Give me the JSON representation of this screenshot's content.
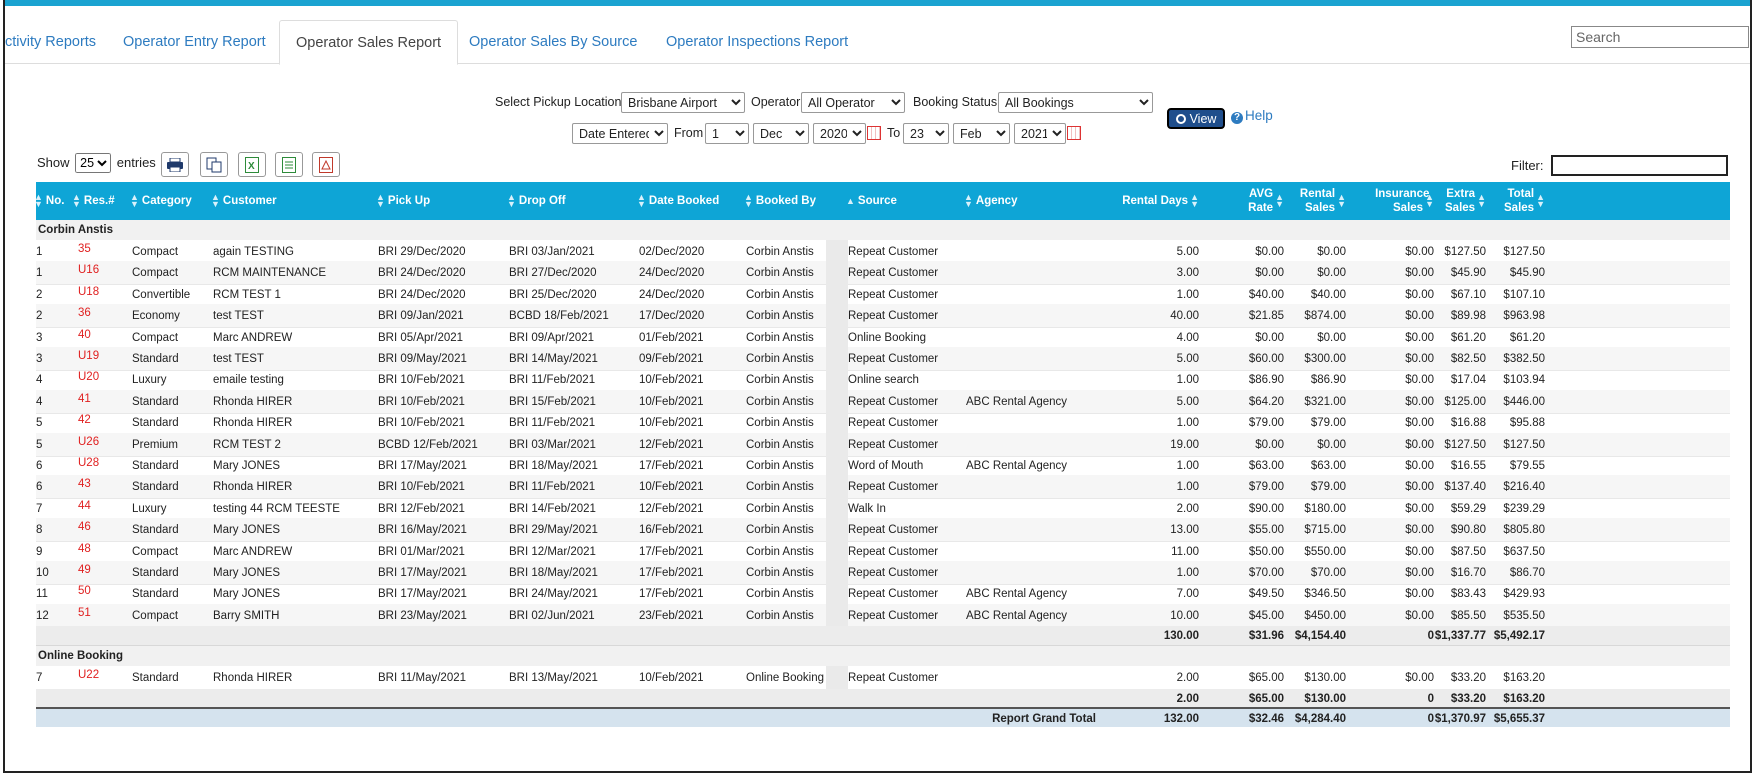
{
  "tabs": [
    {
      "label": "ctivity Reports",
      "left": 0
    },
    {
      "label": "Operator Entry Report"
    },
    {
      "label": "Operator Sales Report",
      "active": true
    },
    {
      "label": "Operator Sales By Source"
    },
    {
      "label": "Operator Inspections Report"
    }
  ],
  "search": {
    "placeholder": "Search"
  },
  "filters": {
    "pickup_label": "Select Pickup Location",
    "pickup_value": "Brisbane Airport",
    "operator_label": "Operator",
    "operator_value": "All Operator",
    "status_label": "Booking Status",
    "status_value": "All Bookings",
    "date_type": "Date Entered",
    "from_label": "From",
    "from_day": "1",
    "from_month": "Dec",
    "from_year": "2020",
    "to_label": "To",
    "to_day": "23",
    "to_month": "Feb",
    "to_year": "2021",
    "view_label": "View",
    "help_label": "Help"
  },
  "table_controls": {
    "show_label": "Show",
    "entries_value": "25",
    "entries_label": "entries",
    "filter_label": "Filter:"
  },
  "columns": [
    "No.",
    "Res.#",
    "Category",
    "Customer",
    "Pick Up",
    "Drop Off",
    "Date Booked",
    "Booked By",
    "Source",
    "Agency",
    "Rental Days",
    "AVG Rate",
    "Rental Sales",
    "Insurance Sales",
    "Extra Sales",
    "Total Sales"
  ],
  "groups": [
    {
      "name": "Corbin Anstis",
      "rows": [
        [
          "1",
          "35",
          "Compact",
          "again TESTING",
          "BRI 29/Dec/2020",
          "BRI 03/Jan/2021",
          "02/Dec/2020",
          "Corbin Anstis",
          "Repeat Customer",
          "",
          "5.00",
          "$0.00",
          "$0.00",
          "$0.00",
          "$127.50",
          "$127.50"
        ],
        [
          "1",
          "U16",
          "Compact",
          "RCM MAINTENANCE",
          "BRI 24/Dec/2020",
          "BRI 27/Dec/2020",
          "24/Dec/2020",
          "Corbin Anstis",
          "Repeat Customer",
          "",
          "3.00",
          "$0.00",
          "$0.00",
          "$0.00",
          "$45.90",
          "$45.90"
        ],
        [
          "2",
          "U18",
          "Convertible",
          "RCM TEST 1",
          "BRI 24/Dec/2020",
          "BRI 25/Dec/2020",
          "24/Dec/2020",
          "Corbin Anstis",
          "Repeat Customer",
          "",
          "1.00",
          "$40.00",
          "$40.00",
          "$0.00",
          "$67.10",
          "$107.10"
        ],
        [
          "2",
          "36",
          "Economy",
          "test TEST",
          "BRI 09/Jan/2021",
          "BCBD 18/Feb/2021",
          "17/Dec/2020",
          "Corbin Anstis",
          "Repeat Customer",
          "",
          "40.00",
          "$21.85",
          "$874.00",
          "$0.00",
          "$89.98",
          "$963.98"
        ],
        [
          "3",
          "40",
          "Compact",
          "Marc ANDREW",
          "BRI 05/Apr/2021",
          "BRI 09/Apr/2021",
          "01/Feb/2021",
          "Corbin Anstis",
          "Online Booking",
          "",
          "4.00",
          "$0.00",
          "$0.00",
          "$0.00",
          "$61.20",
          "$61.20"
        ],
        [
          "3",
          "U19",
          "Standard",
          "test TEST",
          "BRI 09/May/2021",
          "BRI 14/May/2021",
          "09/Feb/2021",
          "Corbin Anstis",
          "Repeat Customer",
          "",
          "5.00",
          "$60.00",
          "$300.00",
          "$0.00",
          "$82.50",
          "$382.50"
        ],
        [
          "4",
          "U20",
          "Luxury",
          "emaile testing",
          "BRI 10/Feb/2021",
          "BRI 11/Feb/2021",
          "10/Feb/2021",
          "Corbin Anstis",
          "Online search",
          "",
          "1.00",
          "$86.90",
          "$86.90",
          "$0.00",
          "$17.04",
          "$103.94"
        ],
        [
          "4",
          "41",
          "Standard",
          "Rhonda HIRER",
          "BRI 10/Feb/2021",
          "BRI 15/Feb/2021",
          "10/Feb/2021",
          "Corbin Anstis",
          "Repeat Customer",
          "ABC Rental Agency",
          "5.00",
          "$64.20",
          "$321.00",
          "$0.00",
          "$125.00",
          "$446.00"
        ],
        [
          "5",
          "42",
          "Standard",
          "Rhonda HIRER",
          "BRI 10/Feb/2021",
          "BRI 11/Feb/2021",
          "10/Feb/2021",
          "Corbin Anstis",
          "Repeat Customer",
          "",
          "1.00",
          "$79.00",
          "$79.00",
          "$0.00",
          "$16.88",
          "$95.88"
        ],
        [
          "5",
          "U26",
          "Premium",
          "RCM TEST 2",
          "BCBD 12/Feb/2021",
          "BRI 03/Mar/2021",
          "12/Feb/2021",
          "Corbin Anstis",
          "Repeat Customer",
          "",
          "19.00",
          "$0.00",
          "$0.00",
          "$0.00",
          "$127.50",
          "$127.50"
        ],
        [
          "6",
          "U28",
          "Standard",
          "Mary JONES",
          "BRI 17/May/2021",
          "BRI 18/May/2021",
          "17/Feb/2021",
          "Corbin Anstis",
          "Word of Mouth",
          "ABC Rental Agency",
          "1.00",
          "$63.00",
          "$63.00",
          "$0.00",
          "$16.55",
          "$79.55"
        ],
        [
          "6",
          "43",
          "Standard",
          "Rhonda HIRER",
          "BRI 10/Feb/2021",
          "BRI 11/Feb/2021",
          "10/Feb/2021",
          "Corbin Anstis",
          "Repeat Customer",
          "",
          "1.00",
          "$79.00",
          "$79.00",
          "$0.00",
          "$137.40",
          "$216.40"
        ],
        [
          "7",
          "44",
          "Luxury",
          "testing 44 RCM TEESTE",
          "BRI 12/Feb/2021",
          "BRI 14/Feb/2021",
          "12/Feb/2021",
          "Corbin Anstis",
          "Walk In",
          "",
          "2.00",
          "$90.00",
          "$180.00",
          "$0.00",
          "$59.29",
          "$239.29"
        ],
        [
          "8",
          "46",
          "Standard",
          "Mary JONES",
          "BRI 16/May/2021",
          "BRI 29/May/2021",
          "16/Feb/2021",
          "Corbin Anstis",
          "Repeat Customer",
          "",
          "13.00",
          "$55.00",
          "$715.00",
          "$0.00",
          "$90.80",
          "$805.80"
        ],
        [
          "9",
          "48",
          "Compact",
          "Marc ANDREW",
          "BRI 01/Mar/2021",
          "BRI 12/Mar/2021",
          "17/Feb/2021",
          "Corbin Anstis",
          "Repeat Customer",
          "",
          "11.00",
          "$50.00",
          "$550.00",
          "$0.00",
          "$87.50",
          "$637.50"
        ],
        [
          "10",
          "49",
          "Standard",
          "Mary JONES",
          "BRI 17/May/2021",
          "BRI 18/May/2021",
          "17/Feb/2021",
          "Corbin Anstis",
          "Repeat Customer",
          "",
          "1.00",
          "$70.00",
          "$70.00",
          "$0.00",
          "$16.70",
          "$86.70"
        ],
        [
          "11",
          "50",
          "Standard",
          "Mary JONES",
          "BRI 17/May/2021",
          "BRI 24/May/2021",
          "17/Feb/2021",
          "Corbin Anstis",
          "Repeat Customer",
          "ABC Rental Agency",
          "7.00",
          "$49.50",
          "$346.50",
          "$0.00",
          "$83.43",
          "$429.93"
        ],
        [
          "12",
          "51",
          "Compact",
          "Barry SMITH",
          "BRI 23/May/2021",
          "BRI 02/Jun/2021",
          "23/Feb/2021",
          "Corbin Anstis",
          "Repeat Customer",
          "ABC Rental Agency",
          "10.00",
          "$45.00",
          "$450.00",
          "$0.00",
          "$85.50",
          "$535.50"
        ]
      ],
      "subtotal": [
        "130.00",
        "$31.96",
        "$4,154.40",
        "0",
        "$1,337.77",
        "$5,492.17"
      ]
    },
    {
      "name": "Online Booking",
      "rows": [
        [
          "7",
          "U22",
          "Standard",
          "Rhonda HIRER",
          "BRI 11/May/2021",
          "BRI 13/May/2021",
          "10/Feb/2021",
          "Online Booking",
          "Repeat Customer",
          "",
          "2.00",
          "$65.00",
          "$130.00",
          "$0.00",
          "$33.20",
          "$163.20"
        ]
      ],
      "subtotal": [
        "2.00",
        "$65.00",
        "$130.00",
        "0",
        "$33.20",
        "$163.20"
      ]
    }
  ],
  "grand_total": {
    "label": "Report Grand Total",
    "values": [
      "132.00",
      "$32.46",
      "$4,284.40",
      "0",
      "$1,370.97",
      "$5,655.37"
    ]
  },
  "colors": {
    "header": "#0ea5d6",
    "link": "#2d7bc0",
    "res": "#e02020",
    "view": "#1f4e8c"
  }
}
